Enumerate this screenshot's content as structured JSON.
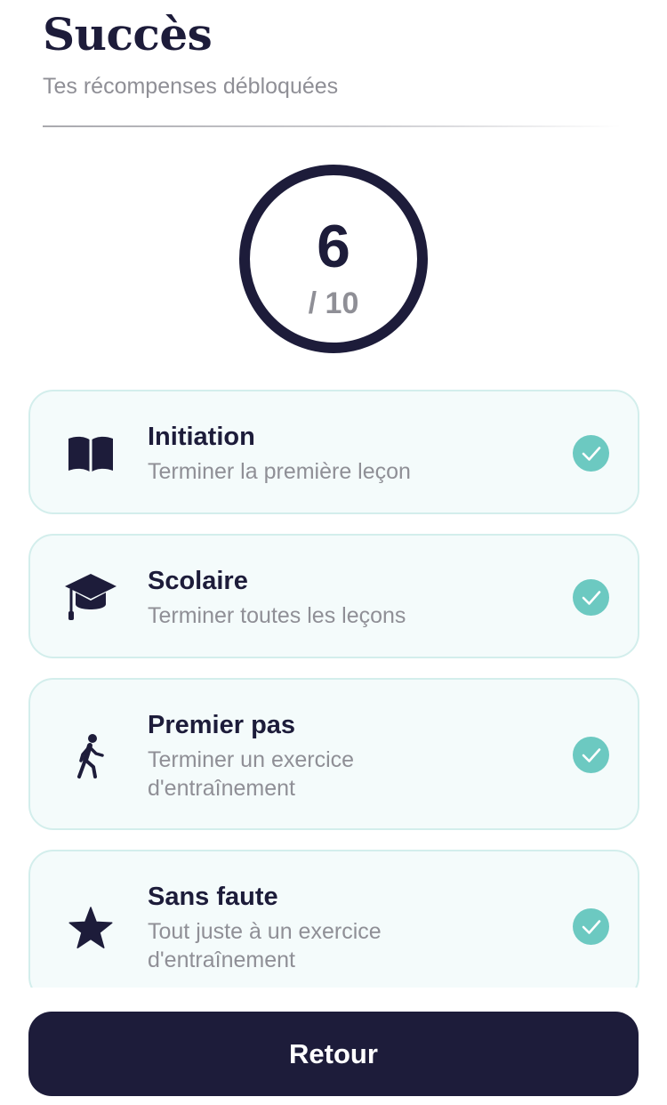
{
  "header": {
    "title": "Succès",
    "subtitle": "Tes récompenses débloquées"
  },
  "progress": {
    "unlocked": "6",
    "total_label": "/ 10",
    "total": 10
  },
  "achievements": [
    {
      "icon": "book-icon",
      "title": "Initiation",
      "description": "Terminer la première leçon",
      "completed": true
    },
    {
      "icon": "graduation-cap-icon",
      "title": "Scolaire",
      "description": "Terminer toutes les leçons",
      "completed": true
    },
    {
      "icon": "walking-person-icon",
      "title": "Premier pas",
      "description": "Terminer un exercice d'entraînement",
      "completed": true
    },
    {
      "icon": "star-icon",
      "title": "Sans faute",
      "description": "Tout juste à un exercice d'entraînement",
      "completed": true
    }
  ],
  "footer": {
    "back_label": "Retour"
  },
  "colors": {
    "primary": "#1d1c3a",
    "accent": "#6cc9c1",
    "muted_text": "#8f8f96",
    "card_bg": "#f4fbfb",
    "card_border": "#d3eeec"
  }
}
